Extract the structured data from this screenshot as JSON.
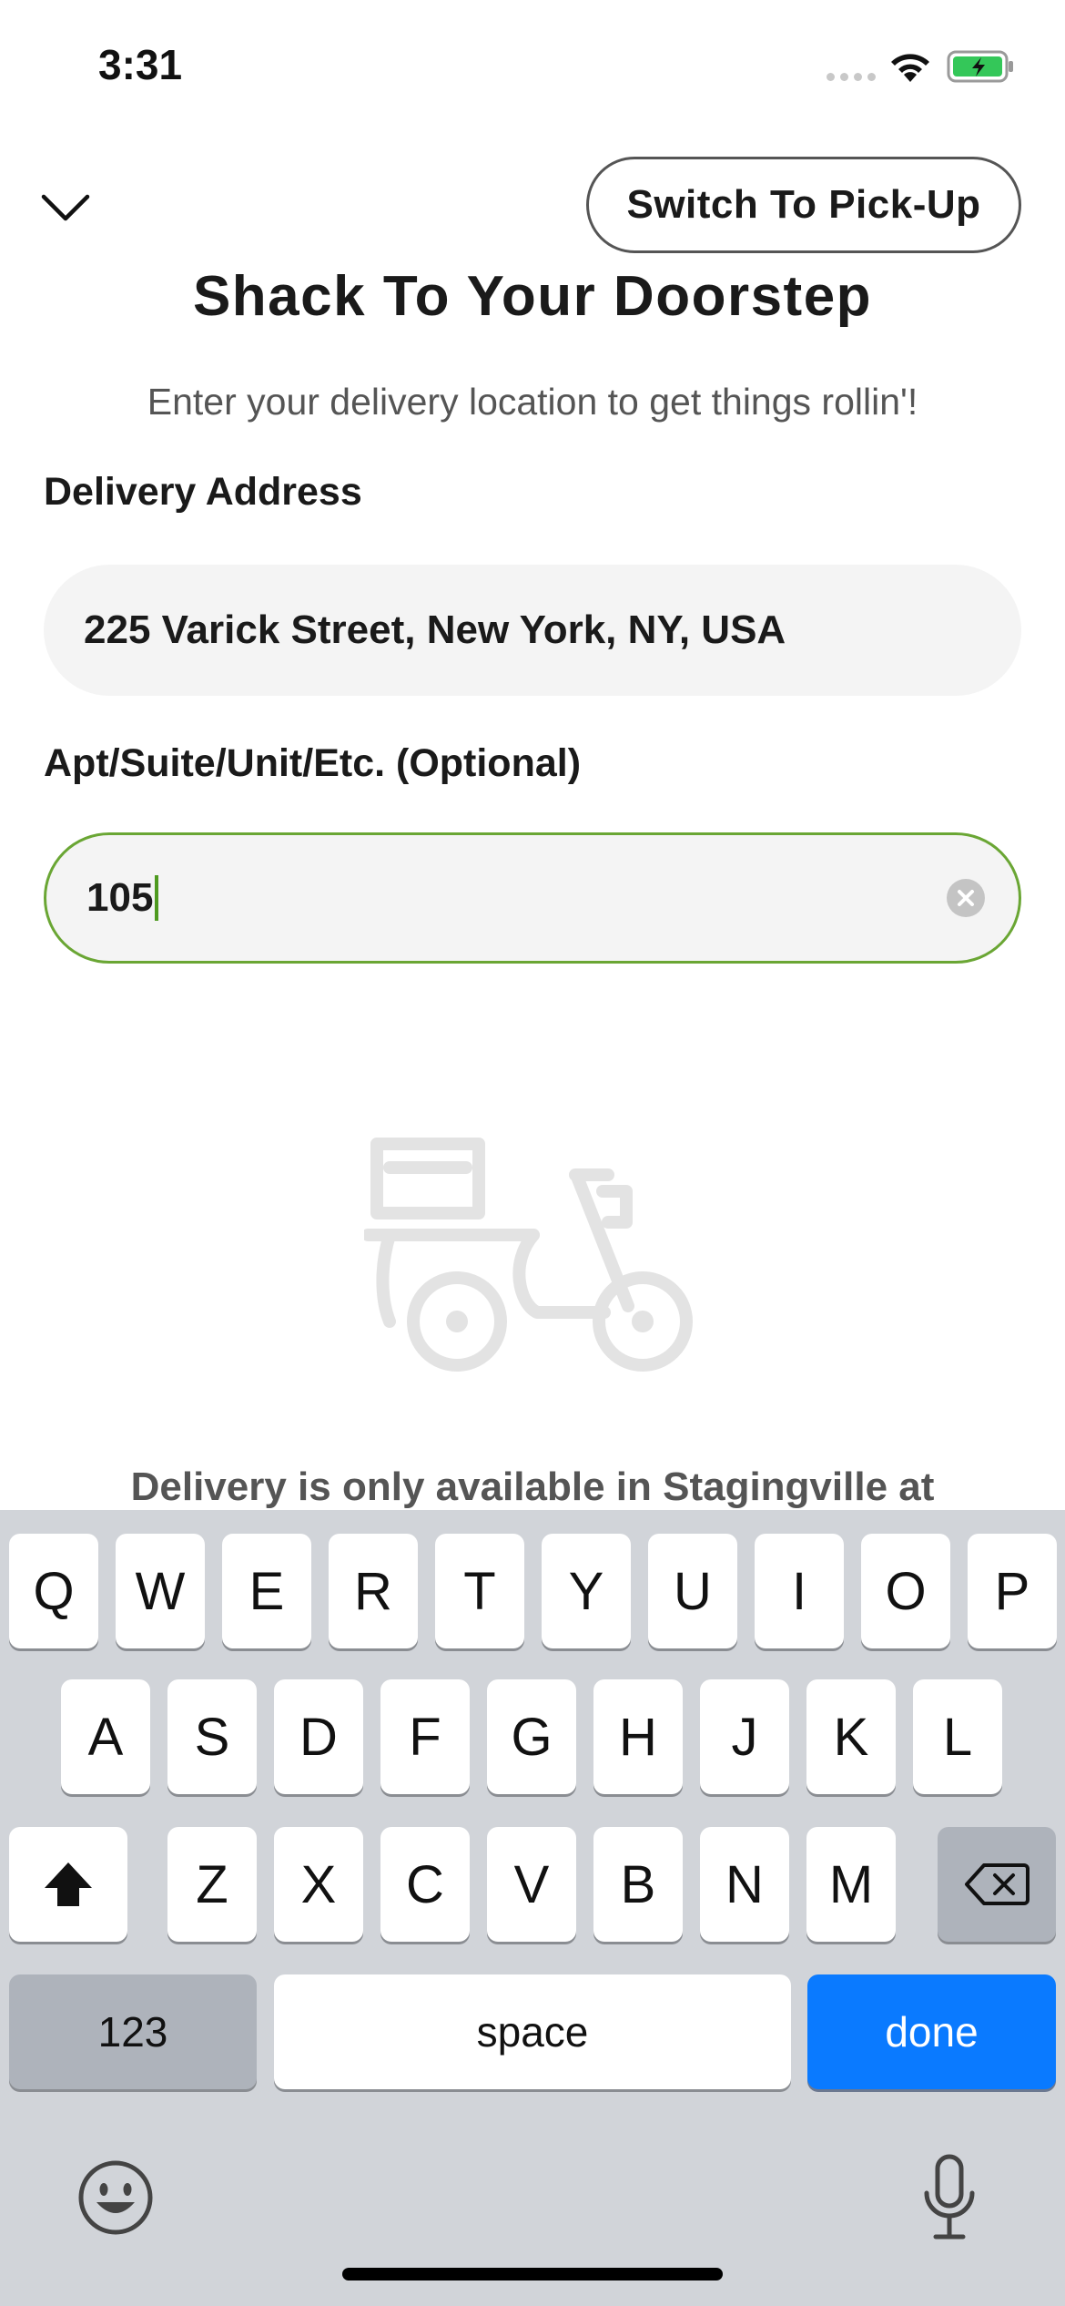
{
  "status_bar": {
    "time": "3:31"
  },
  "header": {
    "switch_label": "Switch To Pick-Up",
    "title": "Shack To Your Doorstep",
    "subtitle": "Enter your delivery location to get things rollin'!"
  },
  "form": {
    "address_label": "Delivery Address",
    "address_value": "225 Varick Street, New York, NY, USA",
    "apt_label": "Apt/Suite/Unit/Etc. (Optional)",
    "apt_value": "105"
  },
  "notice": "Delivery is only available in Stagingville at",
  "keyboard": {
    "row1": [
      "Q",
      "W",
      "E",
      "R",
      "T",
      "Y",
      "U",
      "I",
      "O",
      "P"
    ],
    "row2": [
      "A",
      "S",
      "D",
      "F",
      "G",
      "H",
      "J",
      "K",
      "L"
    ],
    "row3": [
      "Z",
      "X",
      "C",
      "V",
      "B",
      "N",
      "M"
    ],
    "numbers_key": "123",
    "space_key": "space",
    "done_key": "done"
  },
  "colors": {
    "accent_green": "#6aa634",
    "done_blue": "#0a7aff",
    "keyboard_bg": "#d1d4d9"
  },
  "icons": [
    "chevron-down-icon",
    "clear-icon",
    "scooter-icon",
    "shift-icon",
    "backspace-icon",
    "emoji-icon",
    "microphone-icon",
    "wifi-icon",
    "battery-icon"
  ]
}
